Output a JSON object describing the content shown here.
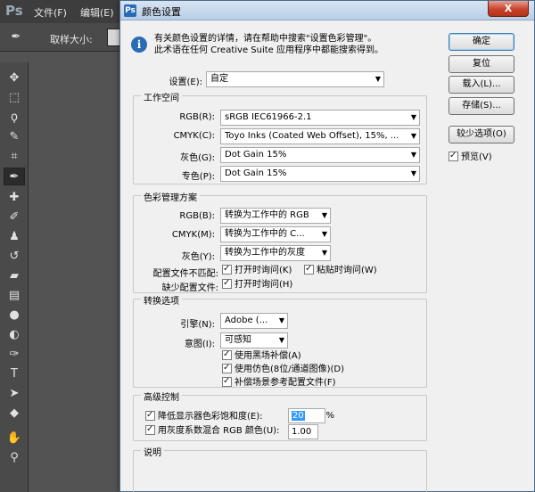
{
  "app": {
    "logo": "Ps",
    "menu": [
      "文件(F)",
      "编辑(E)"
    ],
    "options_label": "取样大小:",
    "tools": [
      "move",
      "marquee",
      "lasso",
      "quick-select",
      "crop",
      "eyedropper",
      "healing",
      "brush",
      "stamp",
      "history",
      "eraser",
      "gradient",
      "blur",
      "dodge",
      "pen",
      "type",
      "path-select",
      "shape",
      "hand",
      "zoom"
    ]
  },
  "dialog": {
    "title": "颜色设置",
    "close_label": "X",
    "info_line1": "有关颜色设置的详情，请在帮助中搜索\"设置色彩管理\"。",
    "info_line2": "此术语在任何 Creative Suite 应用程序中都能搜索得到。",
    "settings_label": "设置(E):",
    "settings_value": "自定",
    "working_spaces": {
      "title": "工作空间",
      "rows": [
        {
          "label": "RGB(R):",
          "value": "sRGB IEC61966-2.1"
        },
        {
          "label": "CMYK(C):",
          "value": "Toyo Inks (Coated Web Offset), 15%, ..."
        },
        {
          "label": "灰色(G):",
          "value": "Dot Gain 15%"
        },
        {
          "label": "专色(P):",
          "value": "Dot Gain 15%"
        }
      ]
    },
    "policies": {
      "title": "色彩管理方案",
      "rows": [
        {
          "label": "RGB(B):",
          "value": "转换为工作中的 RGB"
        },
        {
          "label": "CMYK(M):",
          "value": "转换为工作中的 C..."
        },
        {
          "label": "灰色(Y):",
          "value": "转换为工作中的灰度"
        }
      ],
      "mismatch_label": "配置文件不匹配:",
      "mismatch_open": "打开时询问(K)",
      "mismatch_paste": "粘贴时询问(W)",
      "missing_label": "缺少配置文件:",
      "missing_open": "打开时询问(H)"
    },
    "conversion": {
      "title": "转换选项",
      "engine_label": "引擎(N):",
      "engine_value": "Adobe (...",
      "intent_label": "意图(I):",
      "intent_value": "可感知",
      "checks": [
        "使用黑场补偿(A)",
        "使用仿色(8位/通道图像)(D)",
        "补偿场景参考配置文件(F)"
      ]
    },
    "advanced": {
      "title": "高级控制",
      "desaturate_label": "降低显示器色彩饱和度(E):",
      "desaturate_value": "20",
      "desaturate_unit": "%",
      "blend_label": "用灰度系数混合 RGB 颜色(U):",
      "blend_value": "1.00"
    },
    "description": {
      "title": "说明"
    },
    "buttons": {
      "ok": "确定",
      "reset": "复位",
      "load": "载入(L)...",
      "save": "存储(S)...",
      "fewer": "较少选项(O)",
      "preview": "预览(V)"
    }
  }
}
